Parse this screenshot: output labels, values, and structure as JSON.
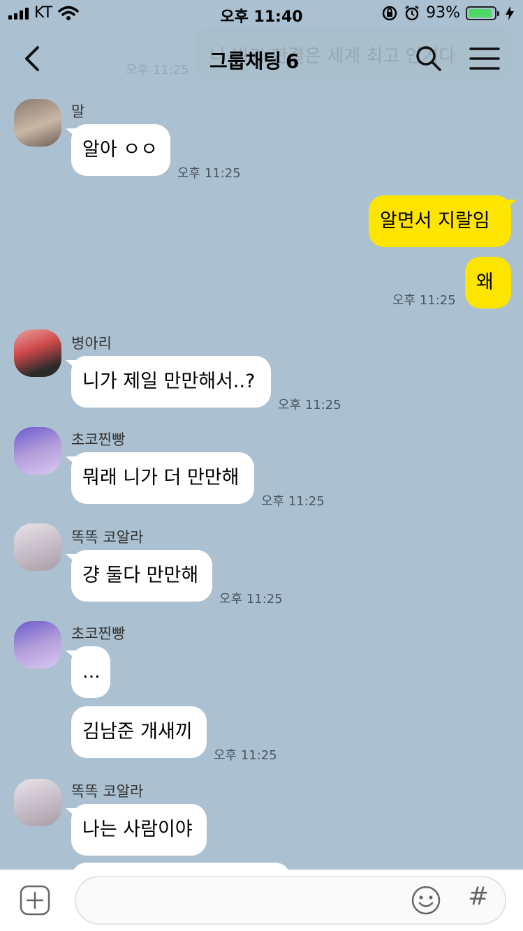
{
  "status_bar": {
    "carrier": "KT",
    "time": "오후 11:40",
    "battery": "93%",
    "battery_level": 0.93,
    "icons": [
      "signal-icon",
      "wifi-icon",
      "rotation-lock-icon",
      "alarm-icon",
      "battery-icon",
      "charging-icon"
    ]
  },
  "header": {
    "title": "그룹채팅",
    "member_count": "6",
    "preview_text": "나 비키 한결은 세계 최고 인거다",
    "preview_time": "오후 11:25"
  },
  "messages": [
    {
      "sender": "말",
      "text": "알아 ㅇㅇ",
      "time": "오후 11:25"
    },
    {
      "sender": "me",
      "text": "알면서 지랄임"
    },
    {
      "sender": "me",
      "text": "왜",
      "time": "오후 11:25"
    },
    {
      "sender": "병아리",
      "text": "니가 제일 만만해서..?",
      "time": "오후 11:25"
    },
    {
      "sender": "초코찐빵",
      "text": "뭐래 니가 더 만만해",
      "time": "오후 11:25"
    },
    {
      "sender": "똑똑 코알라",
      "text": "걍 둘다 만만해",
      "time": "오후 11:25"
    },
    {
      "sender": "초코찐빵",
      "text": "..."
    },
    {
      "sender": "초코찐빵",
      "text": "김남준 개새끼",
      "time": "오후 11:25"
    },
    {
      "sender": "똑똑 코알라",
      "text": "나는 사람이야"
    }
  ],
  "colors": {
    "background": "#abc1d1",
    "my_bubble": "#fee500",
    "other_bubble": "#ffffff",
    "battery_fill": "#4cd964"
  }
}
